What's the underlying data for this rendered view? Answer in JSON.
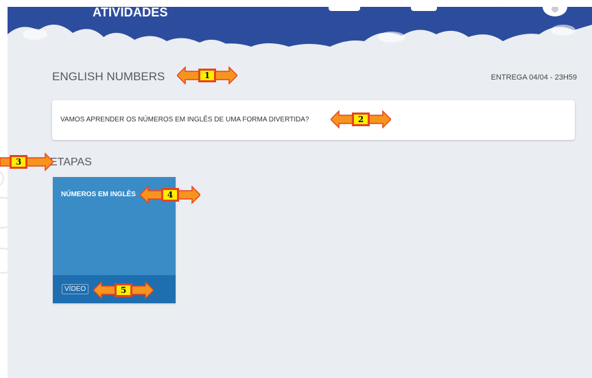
{
  "header": {
    "title": "ATIVIDADES"
  },
  "activity": {
    "title": "ENGLISH NUMBERS",
    "due": "ENTREGA 04/04 - 23H59",
    "description": "VAMOS APRENDER OS NÚMEROS EM INGLÊS DE UMA FORMA DIVERTIDA?"
  },
  "stages": {
    "title": "ETAPAS",
    "items": [
      {
        "name": "NÚMEROS EM INGLÊS",
        "type": "VÍDEO"
      }
    ]
  },
  "annotations": [
    "1",
    "2",
    "3",
    "4",
    "5"
  ],
  "colors": {
    "banner": "#2b4b9c",
    "card": "#3a8cc7",
    "card_footer": "#1f6fb0",
    "callout_fill": "#ffef00",
    "callout_border": "#e8431f",
    "arrow": "#f7941d"
  }
}
